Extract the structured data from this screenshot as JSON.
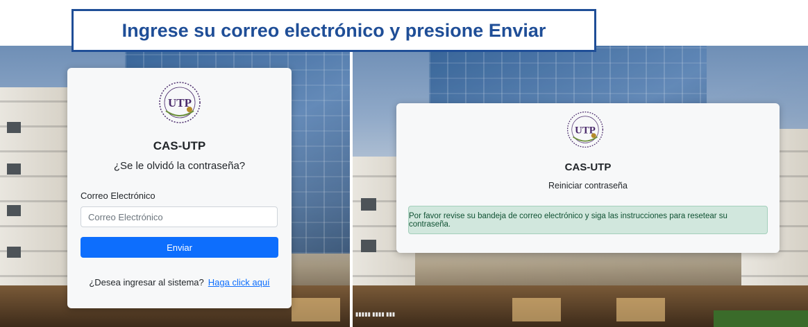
{
  "banner": {
    "text": "Ingrese su correo electrónico y presione Enviar"
  },
  "left_card": {
    "app_name": "CAS-UTP",
    "subtitle": "¿Se le olvidó la contraseña?",
    "email_label": "Correo Electrónico",
    "email_placeholder": "Correo Electrónico",
    "email_value": "",
    "submit_label": "Enviar",
    "footer_text": "¿Desea ingresar al sistema?",
    "footer_link": "Haga click aquí"
  },
  "right_card": {
    "app_name": "CAS-UTP",
    "subtitle": "Reiniciar contraseña",
    "alert_text": "Por favor revise su bandeja de correo electrónico y siga las instrucciones para resetear su contraseña."
  },
  "logo": {
    "name": "utp-seal-icon",
    "initials": "UTP",
    "color": "#4a2a6b",
    "accent": "#b58b2a"
  },
  "colors": {
    "banner": "#1f4e97",
    "primary_button": "#0d6efd",
    "alert_bg": "#d1e7dd",
    "alert_text": "#0f5132"
  }
}
